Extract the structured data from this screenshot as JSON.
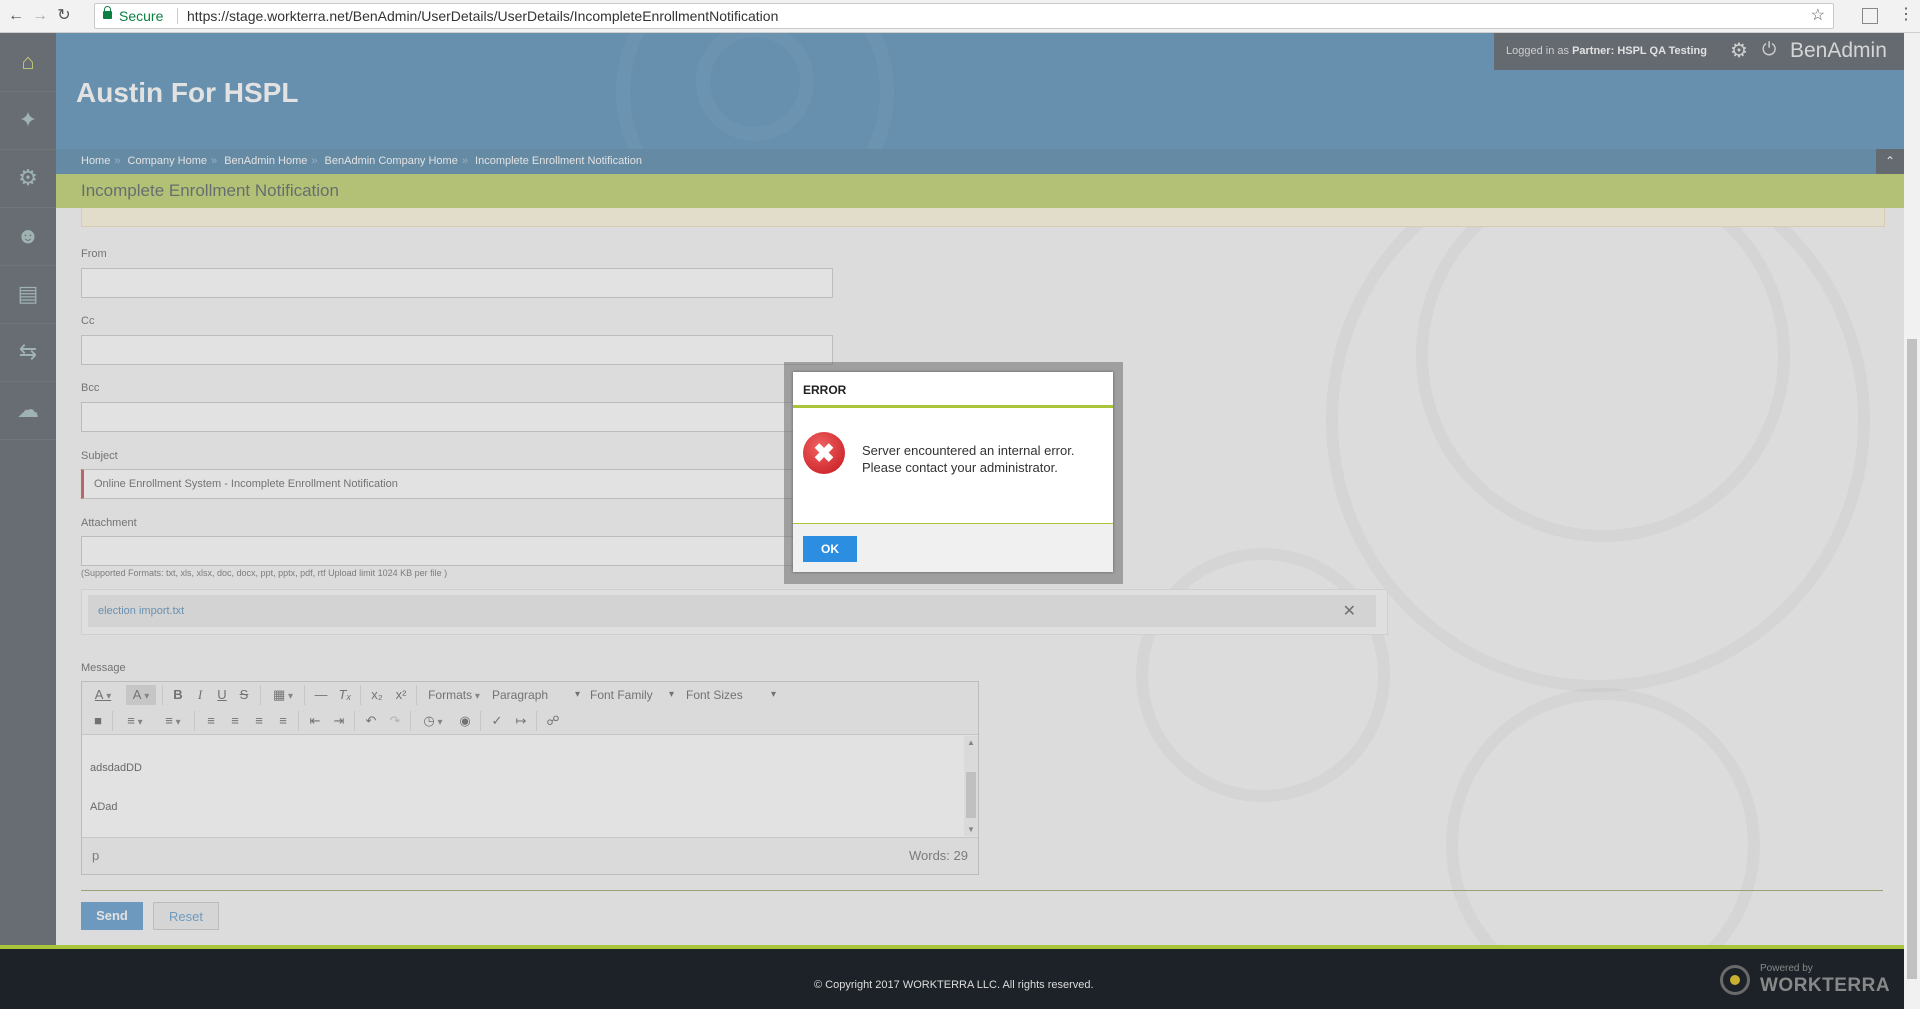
{
  "browser": {
    "secure_label": "Secure",
    "url": "https://stage.workterra.net/BenAdmin/UserDetails/UserDetails/IncompleteEnrollmentNotification"
  },
  "rail": {
    "items": [
      "home-icon",
      "puzzle-icon",
      "user-settings-icon",
      "user-icon",
      "bar-chart-icon",
      "transfer-icon",
      "chat-icon"
    ]
  },
  "header": {
    "site_title": "Austin For HSPL",
    "logged_in_prefix": "Logged in as",
    "role": "Partner:",
    "partner_name": "HSPL QA Testing",
    "app_name": "BenAdmin"
  },
  "breadcrumb": {
    "items": [
      "Home",
      "Company Home",
      "BenAdmin Home",
      "BenAdmin Company Home",
      "Incomplete Enrollment Notification"
    ]
  },
  "page": {
    "title": "Incomplete Enrollment Notification"
  },
  "form": {
    "from_label": "From",
    "from_value": "",
    "cc_label": "Cc",
    "cc_value": "",
    "bcc_label": "Bcc",
    "bcc_value": "",
    "subject_label": "Subject",
    "subject_value": "Online Enrollment System - Incomplete Enrollment Notification",
    "attachment_label": "Attachment",
    "attachment_hint": "(Supported Formats: txt, xls, xlsx, doc, docx, ppt, pptx, pdf, rtf Upload limit 1024 KB per file )",
    "attached_file": "election import.txt",
    "message_label": "Message"
  },
  "editor": {
    "formats_label": "Formats",
    "paragraph_label": "Paragraph",
    "font_family_label": "Font Family",
    "font_sizes_label": "Font Sizes",
    "content_lines": [
      "adsdadDD",
      "ADad"
    ],
    "path": "p",
    "word_count": "Words: 29"
  },
  "actions": {
    "send_label": "Send",
    "reset_label": "Reset"
  },
  "footer": {
    "copyright": "© Copyright 2017 WORKTERRA LLC. All rights reserved.",
    "powered_by": "Powered by",
    "brand": "WORKTERRA"
  },
  "dialog": {
    "title": "ERROR",
    "message": "Server encountered an internal error. Please contact your administrator.",
    "ok_label": "OK"
  },
  "colors": {
    "header_blue": "#1e6aa0",
    "accent_green": "#a8c43a",
    "primary_button": "#2c7bbf",
    "error_red": "#c4161c"
  }
}
